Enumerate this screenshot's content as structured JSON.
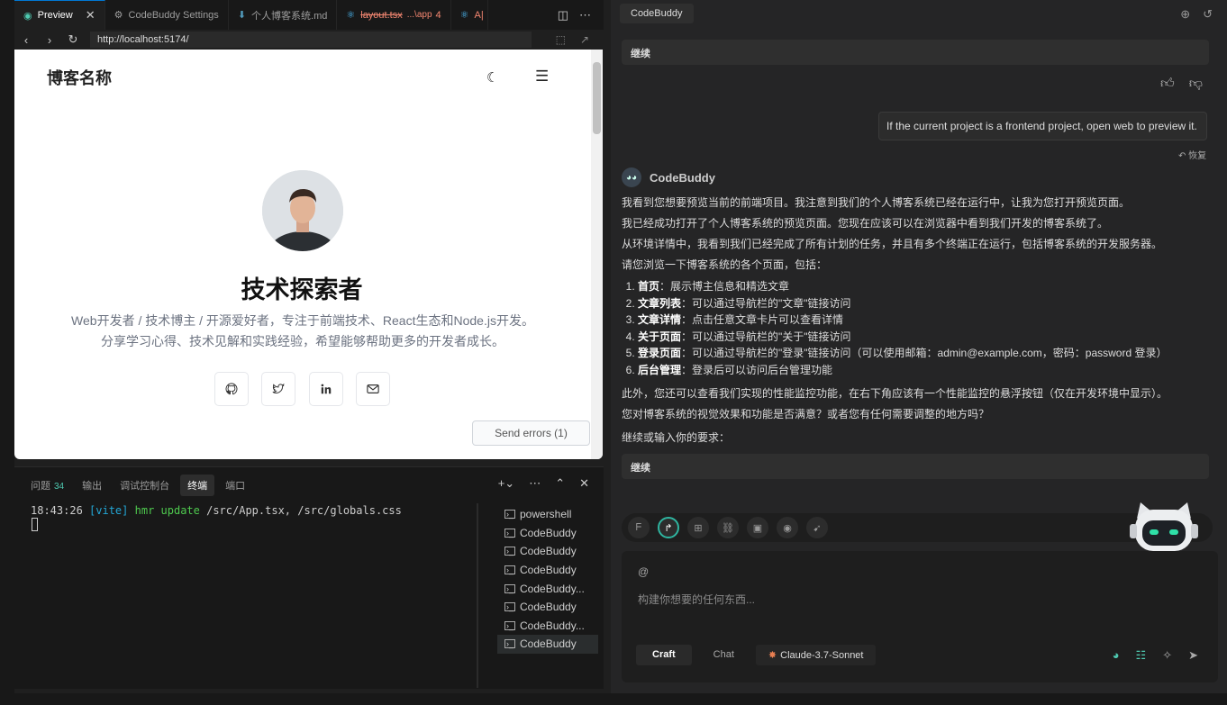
{
  "editor": {
    "tabs": [
      {
        "label": "Preview",
        "icon": "eye-icon"
      },
      {
        "label": "CodeBuddy Settings",
        "icon": "gear-icon"
      },
      {
        "label": "个人博客系统.md",
        "icon": "download-arrow-icon"
      },
      {
        "label": "layout.tsx",
        "path": "...\\app",
        "count": "4",
        "icon": "react-icon"
      },
      {
        "label": "A|",
        "icon": "react-icon"
      }
    ]
  },
  "browser": {
    "url": "http://localhost:5174/"
  },
  "blog": {
    "site_name": "博客名称",
    "author_name": "技术探索者",
    "bio": "Web开发者 / 技术博主 / 开源爱好者，专注于前端技术、React生态和Node.js开发。 分享学习心得、技术见解和实践经验，希望能够帮助更多的开发者成长。",
    "send_errors": "Send errors (1)"
  },
  "panel": {
    "tabs": [
      {
        "label": "问题",
        "badge": "34"
      },
      {
        "label": "输出"
      },
      {
        "label": "调试控制台"
      },
      {
        "label": "终端"
      },
      {
        "label": "端口"
      }
    ],
    "terminal": {
      "time": "18:43:26",
      "tag": "[vite]",
      "event": "hmr update",
      "files": "/src/App.tsx, /src/globals.css"
    },
    "terminal_list": [
      "powershell",
      "CodeBuddy",
      "CodeBuddy",
      "CodeBuddy",
      "CodeBuddy...",
      "CodeBuddy",
      "CodeBuddy...",
      "CodeBuddy"
    ]
  },
  "chat": {
    "tab_label": "CodeBuddy",
    "prev_user_msg": "继续",
    "user_prompt": "If the current project is a frontend project, open web to preview it.",
    "restore_label": "恢复",
    "bot_name": "CodeBuddy",
    "reply": {
      "p1": "我看到您想要预览当前的前端项目。我注意到我们的个人博客系统已经在运行中，让我为您打开预览页面。",
      "p2": "我已经成功打开了个人博客系统的预览页面。您现在应该可以在浏览器中看到我们开发的博客系统了。",
      "p3": "从环境详情中，我看到我们已经完成了所有计划的任务，并且有多个终端正在运行，包括博客系统的开发服务器。",
      "p4": "请您浏览一下博客系统的各个页面，包括：",
      "items": [
        {
          "title": "首页",
          "text": "：展示博主信息和精选文章"
        },
        {
          "title": "文章列表",
          "text": "：可以通过导航栏的\"文章\"链接访问"
        },
        {
          "title": "文章详情",
          "text": "：点击任意文章卡片可以查看详情"
        },
        {
          "title": "关于页面",
          "text": "：可以通过导航栏的\"关于\"链接访问"
        },
        {
          "title": "登录页面",
          "text": "：可以通过导航栏的\"登录\"链接访问（可以使用邮箱：admin@example.com，密码：password 登录）"
        },
        {
          "title": "后台管理",
          "text": "：登录后可以访问后台管理功能"
        }
      ],
      "p5": "此外，您还可以查看我们实现的性能监控功能，在右下角应该有一个性能监控的悬浮按钮（仅在开发环境中显示）。",
      "p6": "您对博客系统的视觉效果和功能是否满意？或者您有任何需要调整的地方吗？",
      "p7": "继续或输入你的要求：",
      "continue": "继续"
    },
    "input": {
      "at": "@",
      "placeholder": "构建你想要的任何东西...",
      "modes": [
        "Craft",
        "Chat"
      ],
      "model": "Claude-3.7-Sonnet"
    }
  }
}
